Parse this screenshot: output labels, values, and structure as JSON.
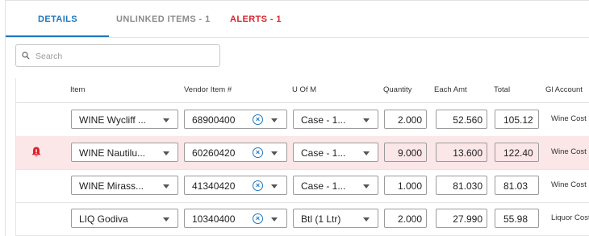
{
  "tabs": {
    "details": "DETAILS",
    "unlinked": "UNLINKED ITEMS - 1",
    "alerts": "ALERTS - 1"
  },
  "search": {
    "placeholder": "Search"
  },
  "columns": {
    "item": "Item",
    "vendor_item": "Vendor Item #",
    "uom": "U Of M",
    "quantity": "Quantity",
    "each_amt": "Each Amt",
    "total": "Total",
    "gl_account": "Gl Account"
  },
  "rows": [
    {
      "item": "WINE Wycliff ...",
      "vendor_item": "68900400",
      "uom": "Case - 1...",
      "quantity": "2.000",
      "each_amt": "52.560",
      "total": "105.12",
      "gl": "Wine Cost",
      "alert": false
    },
    {
      "item": "WINE Nautilu...",
      "vendor_item": "60260420",
      "uom": "Case - 1...",
      "quantity": "9.000",
      "each_amt": "13.600",
      "total": "122.40",
      "gl": "Wine Cost",
      "alert": true
    },
    {
      "item": "WINE Mirass...",
      "vendor_item": "41340420",
      "uom": "Case - 1...",
      "quantity": "1.000",
      "each_amt": "81.030",
      "total": "81.03",
      "gl": "Wine Cost",
      "alert": false
    },
    {
      "item": "LIQ Godiva",
      "vendor_item": "10340400",
      "uom": "Btl (1 Ltr)",
      "quantity": "2.000",
      "each_amt": "27.990",
      "total": "55.98",
      "gl": "Liquor Cost",
      "alert": false
    }
  ],
  "icons": {
    "alert": "bell-alert-icon",
    "clear": "clear-circle-icon",
    "search": "search-icon",
    "dropdown": "chevron-down-icon"
  },
  "colors": {
    "accent": "#1f75bd",
    "alert": "#d9232b",
    "alert_row": "#fbe6e8"
  }
}
